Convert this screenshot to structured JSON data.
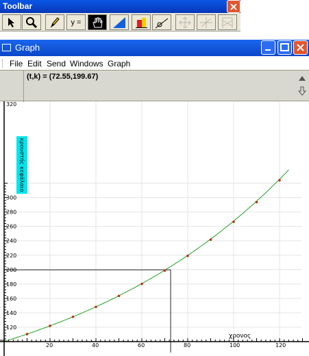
{
  "toolbar": {
    "title": "Toolbar",
    "tools": [
      {
        "icon": "arrow-pointer-icon"
      },
      {
        "icon": "magnifier-icon"
      },
      {
        "icon": "pencil-icon"
      },
      {
        "icon": "y-equals-icon",
        "label": "y ="
      },
      {
        "icon": "hand-icon",
        "active": true
      },
      {
        "icon": "slope-triangle-icon"
      },
      {
        "icon": "bar-color-icon"
      },
      {
        "icon": "tangent-line-icon"
      },
      {
        "icon": "move-cross-icon",
        "disabled": true
      },
      {
        "icon": "crosshair-icon",
        "disabled": true
      },
      {
        "icon": "area-hatch-icon",
        "disabled": true
      }
    ]
  },
  "graph_window": {
    "title": "Graph",
    "menu": [
      "File",
      "Edit",
      "Send",
      "Windows",
      "Graph"
    ],
    "coord_readout": "(t,k) = (72.55,199.67)"
  },
  "chart_data": {
    "type": "scatter",
    "xlabel": "χρονος",
    "ylabel": "κρουστής κεφάλαιο",
    "xlim": [
      0,
      130
    ],
    "ylim": [
      100,
      320
    ],
    "x_ticks": [
      20,
      40,
      60,
      80,
      100,
      120
    ],
    "y_ticks": [
      120,
      140,
      160,
      180,
      200,
      220,
      240,
      260,
      280,
      300
    ],
    "y_top_partial_label": "320",
    "grid": true,
    "series": [
      {
        "x": [
          10,
          20,
          30,
          40,
          50,
          60,
          70,
          80,
          90,
          100,
          110,
          120
        ],
        "y": [
          110.5,
          121.9,
          134.4,
          148.2,
          163.4,
          180.2,
          198.7,
          219.1,
          241.6,
          266.4,
          293.7,
          323.9
        ],
        "marker_color": "#c03010",
        "line_color": "#20a020"
      }
    ],
    "guide_point": {
      "x": 72.55,
      "y": 199.67
    }
  }
}
